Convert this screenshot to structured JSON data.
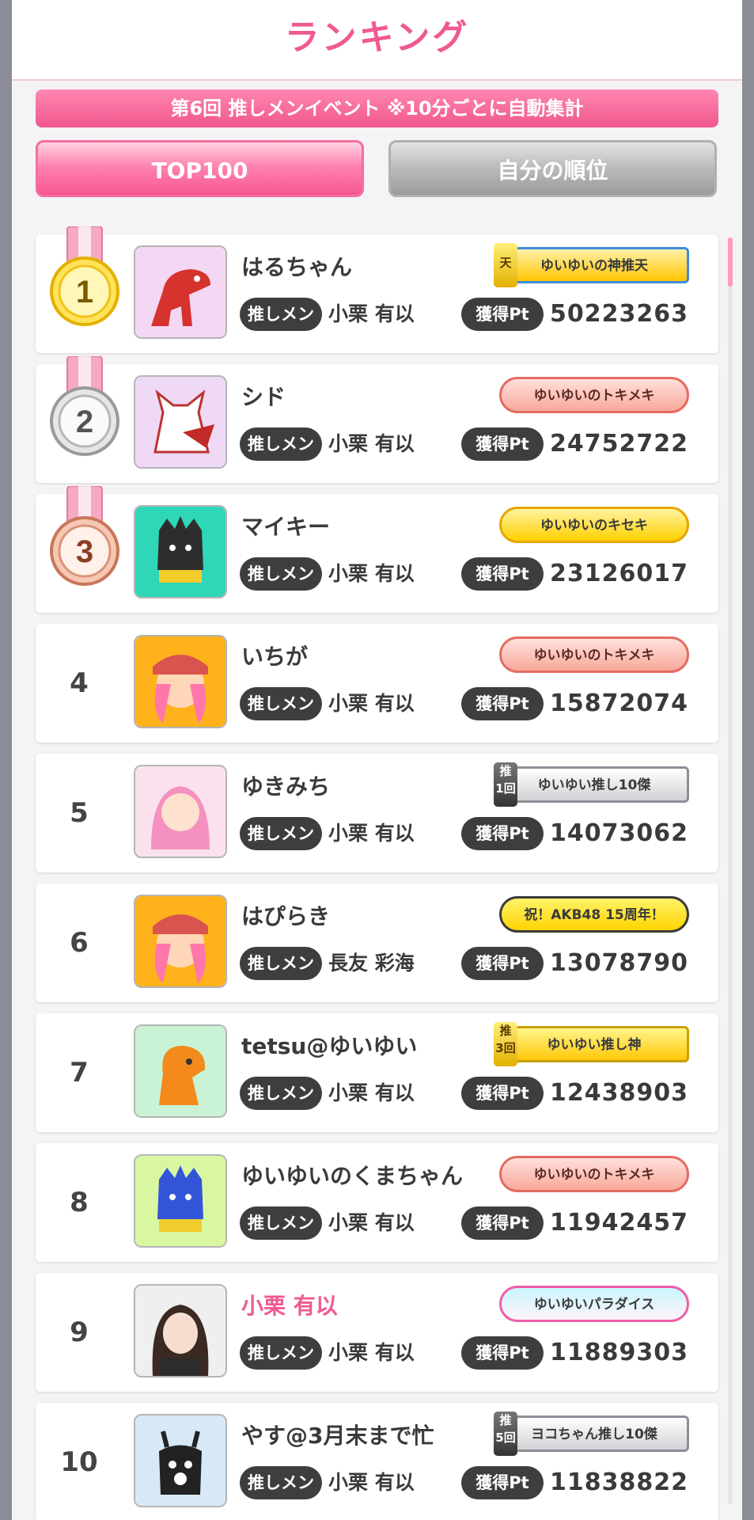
{
  "header": {
    "title": "ランキング",
    "banner": "第6回 推しメンイベント ※10分ごとに自動集計"
  },
  "tabs": [
    {
      "label": "TOP100",
      "active": true
    },
    {
      "label": "自分の順位",
      "active": false
    }
  ],
  "labels": {
    "oshimen": "推しメン",
    "points": "獲得Pt"
  },
  "rows": [
    {
      "rank": "1",
      "name": "はるちゃん",
      "member": "小栗 有以",
      "points": "50223263",
      "badge": "ゆいゆいの神推天",
      "corner": "天",
      "avatar": "red-dinosaur"
    },
    {
      "rank": "2",
      "name": "シド",
      "member": "小栗 有以",
      "points": "24752722",
      "badge": "ゆいゆいのトキメキ",
      "corner": "",
      "avatar": "fox-mask"
    },
    {
      "rank": "3",
      "name": "マイキー",
      "member": "小栗 有以",
      "points": "23126017",
      "badge": "ゆいゆいのキセキ",
      "corner": "",
      "avatar": "black-monster"
    },
    {
      "rank": "4",
      "name": "いちが",
      "member": "小栗 有以",
      "points": "15872074",
      "badge": "ゆいゆいのトキメキ",
      "corner": "",
      "avatar": "anniversary-girl"
    },
    {
      "rank": "5",
      "name": "ゆきみち",
      "member": "小栗 有以",
      "points": "14073062",
      "badge": "ゆいゆい推し10傑",
      "corner": "推\n1回",
      "avatar": "pink-girl"
    },
    {
      "rank": "6",
      "name": "はぴらき",
      "member": "長友 彩海",
      "points": "13078790",
      "badge": "祝！AKB48 15周年！",
      "corner": "",
      "avatar": "anniversary-girl"
    },
    {
      "rank": "7",
      "name": "tetsu@ゆいゆい",
      "member": "小栗 有以",
      "points": "12438903",
      "badge": "ゆいゆい推し神",
      "corner": "推\n3回",
      "avatar": "orange-dragon"
    },
    {
      "rank": "8",
      "name": "ゆいゆいのくまちゃん",
      "member": "小栗 有以",
      "points": "11942457",
      "badge": "ゆいゆいのトキメキ",
      "corner": "",
      "avatar": "blue-monster"
    },
    {
      "rank": "9",
      "name": "小栗 有以",
      "member": "小栗 有以",
      "points": "11889303",
      "badge": "ゆいゆいパラダイス",
      "corner": "",
      "avatar": "photo"
    },
    {
      "rank": "10",
      "name": "やす@3月末まで忙",
      "member": "小栗 有以",
      "points": "11838822",
      "badge": "ヨコちゃん推し10傑",
      "corner": "推\n5回",
      "avatar": "black-deer"
    }
  ],
  "colors": {
    "accent": "#ef5a92",
    "dark_pill": "#3e3e3e"
  }
}
